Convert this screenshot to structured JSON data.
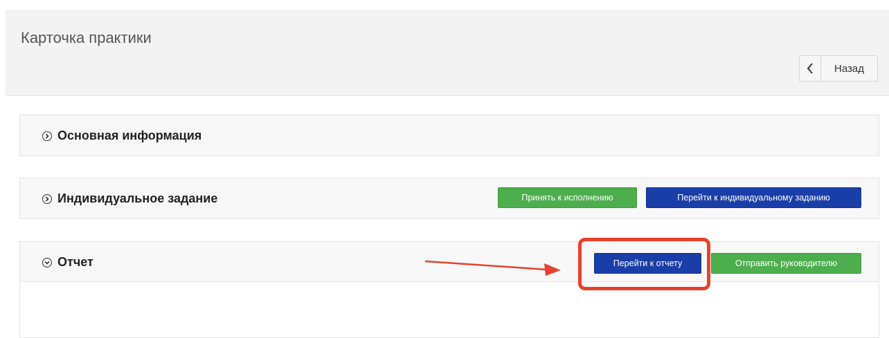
{
  "header": {
    "title": "Карточка практики",
    "back_label": "Назад"
  },
  "sections": [
    {
      "title": "Основная информация",
      "expanded": false
    },
    {
      "title": "Индивидуальное задание",
      "expanded": false,
      "buttons": {
        "accept": "Принять к исполнению",
        "goto_task": "Перейти к индивидуальному заданию"
      }
    },
    {
      "title": "Отчет",
      "expanded": true,
      "buttons": {
        "goto_report": "Перейти к отчету",
        "send": "Отправить руководителю"
      }
    }
  ],
  "colors": {
    "green": "#4cae4c",
    "blue": "#1a3ea8",
    "annotation": "#e8412c"
  }
}
